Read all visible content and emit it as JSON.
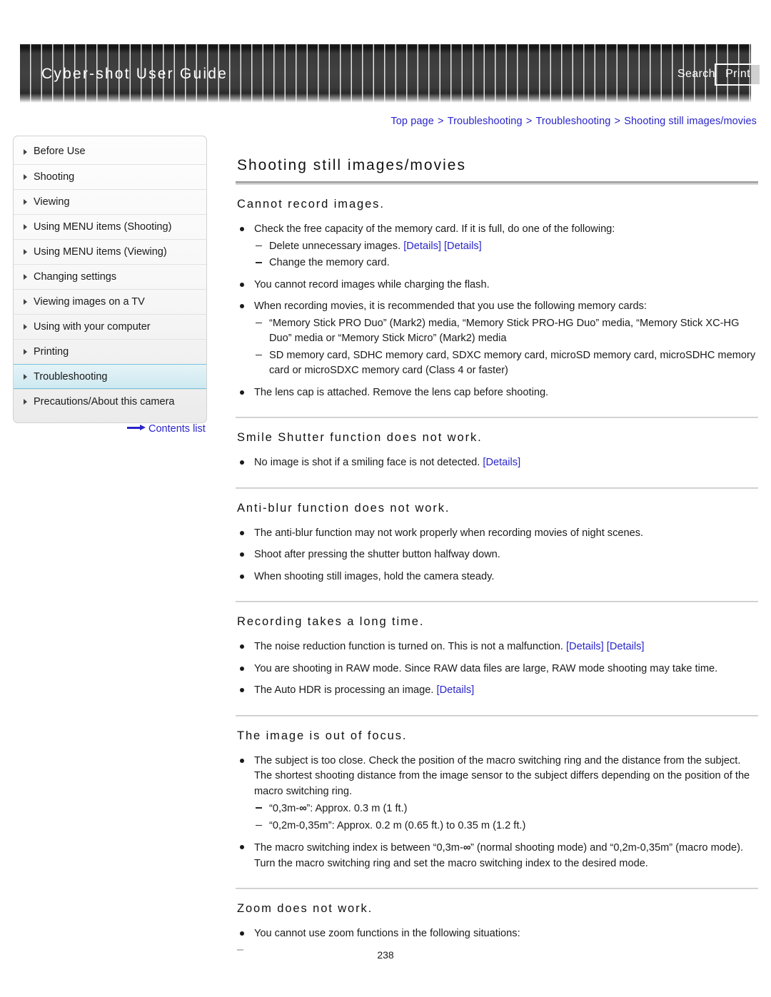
{
  "header": {
    "title": "Cyber-shot User Guide",
    "search_label": "Search",
    "print_label": "Print"
  },
  "breadcrumb": {
    "items": [
      "Top page",
      "Troubleshooting",
      "Troubleshooting",
      "Shooting still images/movies"
    ],
    "separator": ">"
  },
  "sidebar": {
    "items": [
      {
        "label": "Before Use",
        "active": false
      },
      {
        "label": "Shooting",
        "active": false
      },
      {
        "label": "Viewing",
        "active": false
      },
      {
        "label": "Using MENU items (Shooting)",
        "active": false
      },
      {
        "label": "Using MENU items (Viewing)",
        "active": false
      },
      {
        "label": "Changing settings",
        "active": false
      },
      {
        "label": "Viewing images on a TV",
        "active": false
      },
      {
        "label": "Using with your computer",
        "active": false
      },
      {
        "label": "Printing",
        "active": false
      },
      {
        "label": "Troubleshooting",
        "active": true
      },
      {
        "label": "Precautions/About this camera",
        "active": false
      }
    ],
    "contents_link": "Contents list"
  },
  "main": {
    "page_title": "Shooting still images/movies",
    "sections": [
      {
        "heading": "Cannot record images.",
        "bullets": [
          {
            "text": "Check the free capacity of the memory card. If it is full, do one of the following:",
            "sub": [
              {
                "pre": "Delete unnecessary images. ",
                "links": [
                  "[Details]",
                  "[Details]"
                ]
              },
              {
                "pre": "Change the memory card.",
                "links": []
              }
            ]
          },
          {
            "text": "You cannot record images while charging the flash.",
            "sub": []
          },
          {
            "text": "When recording movies, it is recommended that you use the following memory cards:",
            "sub": [
              {
                "pre": "“Memory Stick PRO Duo” (Mark2) media, “Memory Stick PRO-HG Duo” media, “Memory Stick XC-HG Duo” media or “Memory Stick Micro” (Mark2) media",
                "links": []
              },
              {
                "pre": "SD memory card, SDHC memory card, SDXC memory card, microSD memory card, microSDHC memory card or microSDXC memory card (Class 4 or faster)",
                "links": []
              }
            ]
          },
          {
            "text": "The lens cap is attached. Remove the lens cap before shooting.",
            "sub": []
          }
        ]
      },
      {
        "heading": "Smile Shutter function does not work.",
        "bullets": [
          {
            "text": "No image is shot if a smiling face is not detected. ",
            "links": [
              "[Details]"
            ],
            "sub": []
          }
        ]
      },
      {
        "heading": "Anti-blur function does not work.",
        "bullets": [
          {
            "text": "The anti-blur function may not work properly when recording movies of night scenes.",
            "sub": []
          },
          {
            "text": "Shoot after pressing the shutter button halfway down.",
            "sub": []
          },
          {
            "text": "When shooting still images, hold the camera steady.",
            "sub": []
          }
        ]
      },
      {
        "heading": "Recording takes a long time.",
        "bullets": [
          {
            "text": "The noise reduction function is turned on. This is not a malfunction. ",
            "links": [
              "[Details]",
              "[Details]"
            ],
            "sub": []
          },
          {
            "text": "You are shooting in RAW mode. Since RAW data files are large, RAW mode shooting may take time.",
            "sub": []
          },
          {
            "text": "The Auto HDR is processing an image. ",
            "links": [
              "[Details]"
            ],
            "sub": []
          }
        ]
      },
      {
        "heading": "The image is out of focus.",
        "bullets": [
          {
            "text": "The subject is too close. Check the position of the macro switching ring and the distance from the subject. The shortest shooting distance from the image sensor to the subject differs depending on the position of the macro switching ring.",
            "sub": [
              {
                "pre": "“0,3m-",
                "inf": "∞",
                "post": "”: Approx. 0.3 m (1 ft.)",
                "links": []
              },
              {
                "pre": "“0,2m-0,35m”: Approx. 0.2 m (0.65 ft.) to 0.35 m (1.2 ft.)",
                "links": []
              }
            ]
          },
          {
            "text_pre": "The macro switching index is between “0,3m-",
            "inf": "∞",
            "text_post": "” (normal shooting mode) and “0,2m-0,35m” (macro mode). Turn the macro switching ring and set the macro switching index to the desired mode.",
            "sub": []
          }
        ]
      },
      {
        "heading": "Zoom does not work.",
        "bullets": [
          {
            "text": "You cannot use zoom functions in the following situations:",
            "sub": []
          }
        ]
      }
    ],
    "page_number": "238"
  }
}
